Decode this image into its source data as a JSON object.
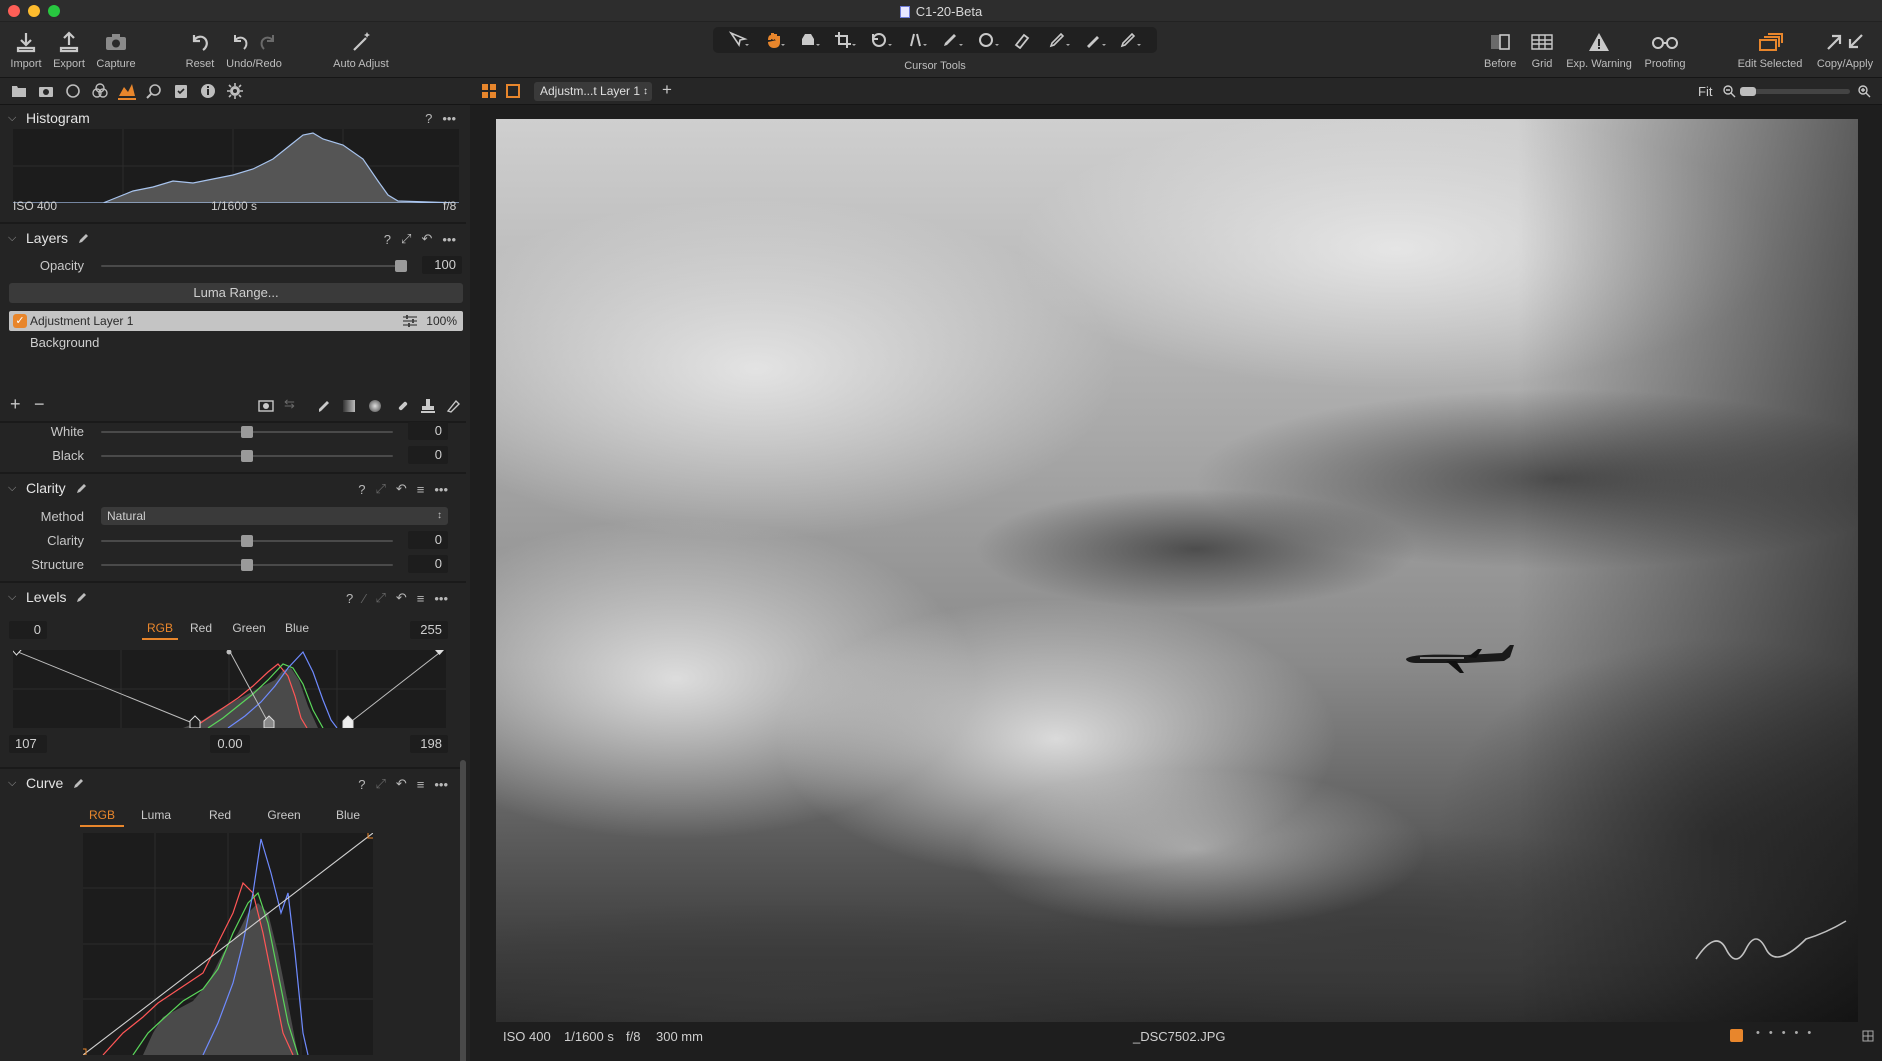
{
  "window": {
    "title": "C1-20-Beta"
  },
  "toolbar": {
    "import": "Import",
    "export": "Export",
    "capture": "Capture",
    "reset": "Reset",
    "undo_redo": "Undo/Redo",
    "auto_adjust": "Auto Adjust",
    "cursor_tools": "Cursor Tools",
    "before": "Before",
    "grid": "Grid",
    "exp_warning": "Exp. Warning",
    "proofing": "Proofing",
    "edit_selected": "Edit Selected",
    "copy_apply": "Copy/Apply"
  },
  "viewer_bar": {
    "layer_select": "Adjustm...t Layer 1",
    "fit": "Fit"
  },
  "histogram": {
    "title": "Histogram",
    "iso": "ISO 400",
    "shutter": "1/1600 s",
    "aperture": "f/8"
  },
  "layers": {
    "title": "Layers",
    "opacity_label": "Opacity",
    "opacity_value": "100",
    "opacity_level": 1.0,
    "luma_range": "Luma Range...",
    "items": [
      {
        "name": "Adjustment Layer 1",
        "opacity": "100%",
        "checked": true
      },
      {
        "name": "Background"
      }
    ]
  },
  "high_dynamic": {
    "white_label": "White",
    "white_value": "0",
    "black_label": "Black",
    "black_value": "0"
  },
  "clarity": {
    "title": "Clarity",
    "method_label": "Method",
    "method_value": "Natural",
    "clarity_label": "Clarity",
    "clarity_value": "0",
    "structure_label": "Structure",
    "structure_value": "0"
  },
  "levels": {
    "title": "Levels",
    "tabs": [
      "RGB",
      "Red",
      "Green",
      "Blue"
    ],
    "selected_tab": "RGB",
    "out_low": "0",
    "out_high": "255",
    "in_low": "107",
    "midtone": "0.00",
    "in_high": "198"
  },
  "curve": {
    "title": "Curve",
    "tabs": [
      "RGB",
      "Luma",
      "Red",
      "Green",
      "Blue"
    ],
    "selected_tab": "RGB"
  },
  "photo_info": {
    "iso": "ISO 400",
    "shutter": "1/1600 s",
    "aperture": "f/8",
    "focal": "300 mm",
    "filename": "_DSC7502.JPG"
  },
  "colors": {
    "accent": "#e8862c",
    "panel": "#242424",
    "toolbar": "#2a2a2a"
  }
}
